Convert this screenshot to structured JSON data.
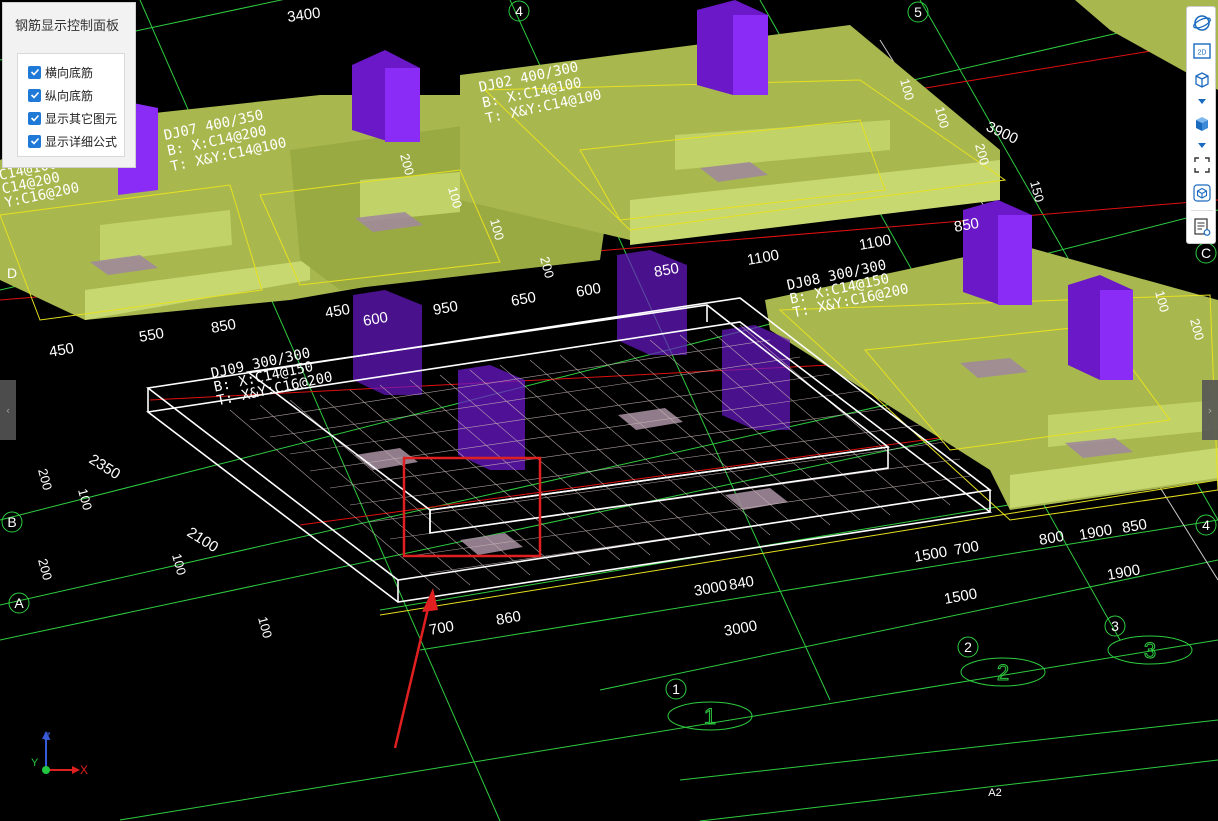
{
  "panel": {
    "title": "钢筋显示控制面板",
    "options": [
      {
        "label": "横向底筋",
        "checked": true
      },
      {
        "label": "纵向底筋",
        "checked": true
      },
      {
        "label": "显示其它图元",
        "checked": true
      },
      {
        "label": "显示详细公式",
        "checked": true
      }
    ]
  },
  "toolbar": {
    "items": [
      "orbit-icon",
      "2d-view-icon",
      "cube-outline-icon",
      "cube-solid-icon",
      "fit-view-icon",
      "box-3d-icon",
      "property-list-icon"
    ],
    "label_2d": "2D"
  },
  "axis": {
    "x": "X",
    "y": "Y",
    "z": "Z"
  },
  "grid": {
    "numbers": [
      "1",
      "2",
      "3",
      "4",
      "5"
    ],
    "letters": [
      "A",
      "B",
      "C",
      "D"
    ],
    "big_labels": [
      "1",
      "2",
      "3"
    ],
    "sub_label": "A2"
  },
  "dimensions": {
    "top_3400": "3400",
    "d3900": "3900",
    "d1100a": "1100",
    "d1100b": "1100",
    "d850a": "850",
    "d450a": "450",
    "d550": "550",
    "d850b": "850",
    "d450b": "450",
    "d950": "950",
    "d650": "650",
    "d600a": "600",
    "d850c": "850",
    "d600b": "600",
    "d2350": "2350",
    "d2100": "2100",
    "d1500a": "1500",
    "d700a": "700",
    "d3000a": "3000",
    "d840": "840",
    "d1500b": "1500",
    "d1900a": "1900",
    "d800": "800",
    "d1900b": "1900",
    "d850d": "850",
    "d3000b": "3000",
    "d700b": "700",
    "d860": "860"
  },
  "rotated_dims": [
    "200",
    "100",
    "200",
    "100",
    "100",
    "200",
    "100",
    "100",
    "200",
    "100",
    "100",
    "200",
    "150",
    "100",
    "200"
  ],
  "annotations": {
    "dj07": [
      "DJ07 400/350",
      "B: X:C14@200",
      "T: X&Y:C14@100"
    ],
    "dj02": [
      "DJ02 400/300",
      "B: X:C14@100",
      "T: X&Y:C14@100"
    ],
    "dj08": [
      "DJ08 300/300",
      "B: X:C14@150",
      "T: X&Y:C16@200"
    ],
    "dj_sel": [
      "DJ09 300/300",
      "B: X:C14@150",
      "T: X&Y:C16@200"
    ],
    "dj_left": [
      "C14@100",
      "C14@200",
      "Y:C16@200"
    ]
  },
  "colors": {
    "footing": "#a8b84e",
    "column": "#7a1fe6",
    "grid": "#2ecc40",
    "redline": "#e01010",
    "yellowline": "#e8e020",
    "highlight": "#e02020"
  }
}
